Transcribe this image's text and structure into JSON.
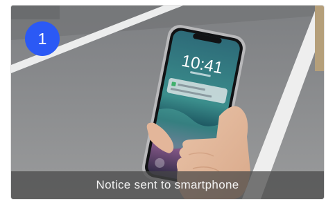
{
  "badge": {
    "number": "1",
    "color": "#2b59f5"
  },
  "caption": {
    "text": "Notice sent to smartphone"
  },
  "phone": {
    "clock": "10:41"
  }
}
